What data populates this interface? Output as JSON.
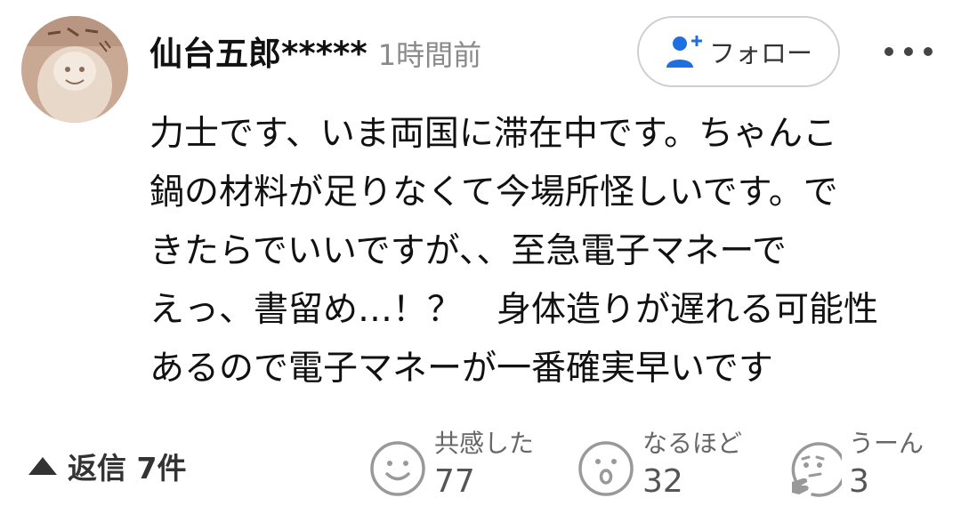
{
  "comment": {
    "username": "仙台五郎*****",
    "timestamp": "1時間前",
    "follow_label": "フォロー",
    "body_lines": [
      "力士です、いま両国に滞在中です。ちゃんこ",
      "鍋の材料が足りなくて今場所怪しいです。で",
      "きたらでいいですが、、至急電子マネーで",
      "えっ、書留め…！？　身体造りが遅れる可能性",
      "あるので電子マネーが一番確実早いです"
    ],
    "replies_label": "返信 7件",
    "reactions": [
      {
        "label": "共感した",
        "count": "77",
        "icon": "smile-face-icon"
      },
      {
        "label": "なるほど",
        "count": "32",
        "icon": "surprised-face-icon"
      },
      {
        "label": "うーん",
        "count": "3",
        "icon": "thinking-face-icon"
      }
    ]
  },
  "icons": {
    "follow": "person-plus-icon",
    "more": "more-options-icon",
    "replies": "triangle-up-icon"
  },
  "colors": {
    "accent_blue": "#1f6fe0",
    "icon_gray": "#999999",
    "border": "#cfcfcf",
    "timestamp": "#8a8a8a"
  }
}
